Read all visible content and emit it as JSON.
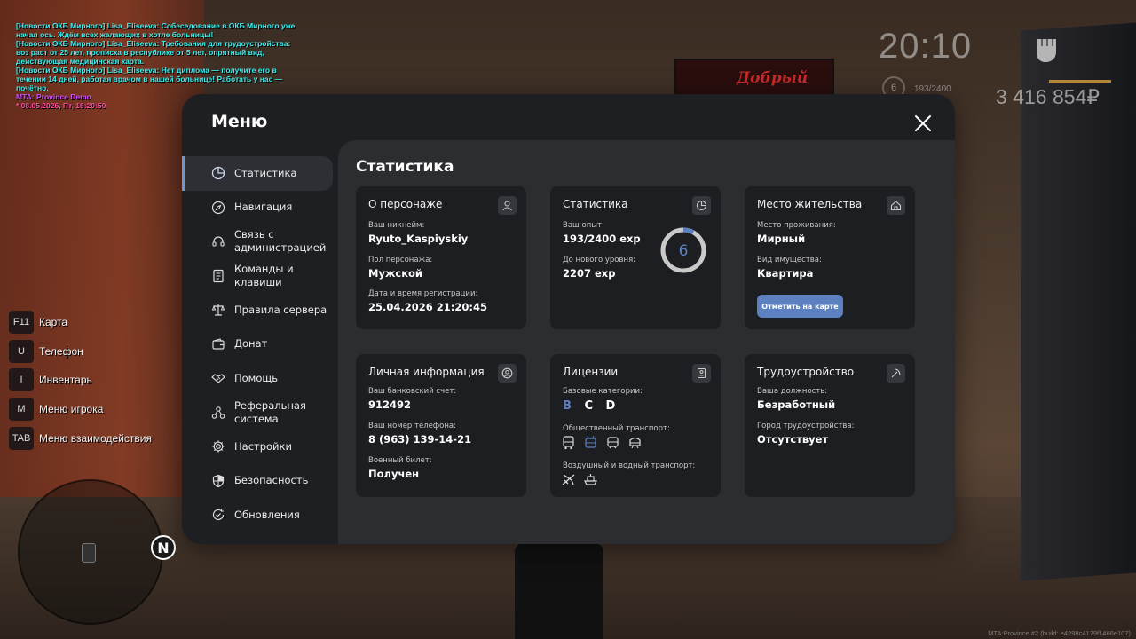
{
  "chat": {
    "lines": [
      "[Новости ОКБ Мирного] Lisa_Eliseeva: Собеседование в ОКБ Мирного уже начал ось. Ждём всех желающих в хотле больницы!",
      "[Новости ОКБ Мирного] Lisa_Eliseeva: Требования для трудоустройства: воз раст от 25 лет, прописка в республике от 5 лет, опрятный вид, действующая медицинская карта.",
      "[Новости ОКБ Мирного] Lisa_Eliseeva: Нет диплома — получите его в течении 14 дней, работая врачом в нашей больнице! Работать у нас — почётно."
    ],
    "mta": "MTA: Province Demo",
    "date": "* 08.05.2026, Пт, 16:20:50"
  },
  "hud": {
    "time": "20:10",
    "level": "6",
    "exp": "193/2400",
    "money": "3 416 854₽"
  },
  "binds": [
    {
      "key": "F11",
      "label": "Карта"
    },
    {
      "key": "U",
      "label": "Телефон"
    },
    {
      "key": "I",
      "label": "Инвентарь"
    },
    {
      "key": "M",
      "label": "Меню игрока"
    },
    {
      "key": "TAB",
      "label": "Меню взаимодействия"
    }
  ],
  "radar": {
    "north": "N"
  },
  "build": "MTA:Province #2 (build: e4298c4179f1466e107)",
  "vending": "Добрый",
  "menu": {
    "title": "Меню",
    "content_title": "Статистика",
    "sidebar": [
      {
        "label": "Статистика",
        "icon": "pie-chart-icon"
      },
      {
        "label": "Навигация",
        "icon": "compass-icon"
      },
      {
        "label": "Связь с администрацией",
        "icon": "headset-icon"
      },
      {
        "label": "Команды и клавиши",
        "icon": "document-icon"
      },
      {
        "label": "Правила сервера",
        "icon": "scales-icon"
      },
      {
        "label": "Донат",
        "icon": "wallet-icon"
      },
      {
        "label": "Помощь",
        "icon": "handshake-icon"
      },
      {
        "label": "Реферальная система",
        "icon": "referral-icon"
      },
      {
        "label": "Настройки",
        "icon": "gear-icon"
      },
      {
        "label": "Безопасность",
        "icon": "shield-icon"
      },
      {
        "label": "Обновления",
        "icon": "refresh-check-icon"
      }
    ],
    "character": {
      "title": "О персонаже",
      "nick_label": "Ваш никнейм:",
      "nick": "Ryuto_Kaspiyskiy",
      "sex_label": "Пол персонажа:",
      "sex": "Мужской",
      "reg_label": "Дата и время регистрации:",
      "reg": "25.04.2026 21:20:45"
    },
    "stats": {
      "title": "Статистика",
      "exp_label": "Ваш опыт:",
      "exp": "193/2400 exp",
      "next_label": "До нового уровня:",
      "next": "2207 exp",
      "level": "6",
      "progress": 0.0804
    },
    "residence": {
      "title": "Место жительства",
      "place_label": "Место проживания:",
      "place": "Мирный",
      "type_label": "Вид имущества:",
      "type": "Квартира",
      "button": "Отметить на карте"
    },
    "personal": {
      "title": "Личная информация",
      "bank_label": "Ваш банковский счет:",
      "bank": "912492",
      "phone_label": "Ваш номер телефона:",
      "phone": "8 (963) 139-14-21",
      "military_label": "Военный билет:",
      "military": "Получен"
    },
    "licenses": {
      "title": "Лицензии",
      "base_label": "Базовые категории:",
      "categories": [
        "B",
        "C",
        "D"
      ],
      "public_label": "Общественный транспорт:",
      "air_label": "Воздушный и водный транспорт:"
    },
    "job": {
      "title": "Трудоустройство",
      "position_label": "Ваша должность:",
      "position": "Безработный",
      "city_label": "Город трудоустройства:",
      "city": "Отсутствует"
    }
  },
  "colors": {
    "accent": "#6e95d6",
    "button": "#5d80c0",
    "panel": "#1e1f22",
    "content": "#2b2d31",
    "card": "#1d1e21"
  }
}
